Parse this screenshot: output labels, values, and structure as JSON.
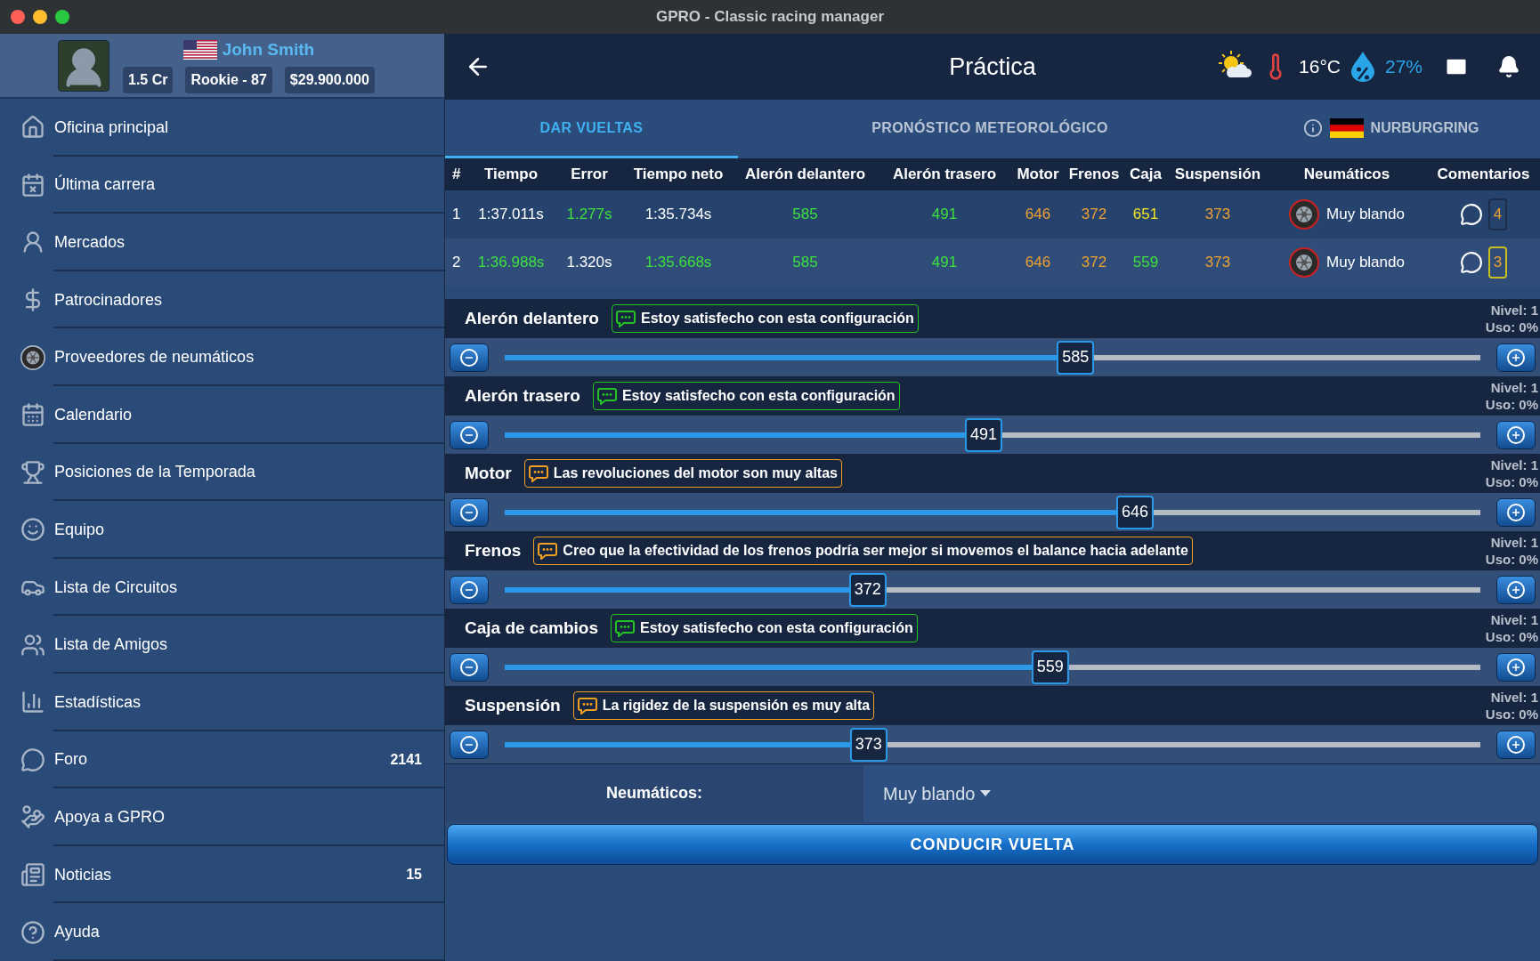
{
  "window": {
    "title": "GPRO - Classic racing manager"
  },
  "profile": {
    "name": "John Smith",
    "badges": [
      "1.5 Cr",
      "Rookie - 87",
      "$29.900.000"
    ]
  },
  "sidebar": {
    "items": [
      {
        "label": "Oficina principal"
      },
      {
        "label": "Última carrera"
      },
      {
        "label": "Mercados"
      },
      {
        "label": "Patrocinadores"
      },
      {
        "label": "Proveedores de neumáticos"
      },
      {
        "label": "Calendario"
      },
      {
        "label": "Posiciones de la Temporada"
      },
      {
        "label": "Equipo"
      },
      {
        "label": "Lista de Circuitos"
      },
      {
        "label": "Lista de Amigos"
      },
      {
        "label": "Estadísticas"
      },
      {
        "label": "Foro",
        "count": "2141"
      },
      {
        "label": "Apoya a GPRO"
      },
      {
        "label": "Noticias",
        "count": "15"
      },
      {
        "label": "Ayuda"
      }
    ]
  },
  "header": {
    "title": "Práctica",
    "temperature": "16°C",
    "humidity": "27%"
  },
  "tabs": [
    {
      "kind": "text",
      "label": "DAR VUELTAS",
      "selected": true
    },
    {
      "kind": "text",
      "label": "PRONÓSTICO METEOROLÓGICO",
      "selected": false
    },
    {
      "kind": "track",
      "label": "NURBURGRING",
      "selected": false
    }
  ],
  "table": {
    "columns": [
      "#",
      "Tiempo",
      "Error",
      "Tiempo neto",
      "Alerón delantero",
      "Alerón trasero",
      "Motor",
      "Frenos",
      "Caja",
      "Suspensión",
      "Neumáticos",
      "Comentarios"
    ],
    "rows": [
      {
        "cells": [
          {
            "text": "1",
            "color": "#ffffff"
          },
          {
            "text": "1:37.011s",
            "color": "#ffffff"
          },
          {
            "text": "1.277s",
            "color": "#3ee03e"
          },
          {
            "text": "1:35.734s",
            "color": "#ffffff"
          },
          {
            "text": "585",
            "color": "#3ee03e"
          },
          {
            "text": "491",
            "color": "#3ee03e"
          },
          {
            "text": "646",
            "color": "#f0a030"
          },
          {
            "text": "372",
            "color": "#f0a030"
          },
          {
            "text": "651",
            "color": "#f2e424"
          },
          {
            "text": "373",
            "color": "#f0a030"
          }
        ],
        "tire": "Muy blando",
        "comments": {
          "count": "4",
          "selected": false
        }
      },
      {
        "cells": [
          {
            "text": "2",
            "color": "#ffffff"
          },
          {
            "text": "1:36.988s",
            "color": "#3ee03e"
          },
          {
            "text": "1.320s",
            "color": "#ffffff"
          },
          {
            "text": "1:35.668s",
            "color": "#3ee03e"
          },
          {
            "text": "585",
            "color": "#3ee03e"
          },
          {
            "text": "491",
            "color": "#3ee03e"
          },
          {
            "text": "646",
            "color": "#f0a030"
          },
          {
            "text": "372",
            "color": "#f0a030"
          },
          {
            "text": "559",
            "color": "#3ee03e"
          },
          {
            "text": "373",
            "color": "#f0a030"
          }
        ],
        "tire": "Muy blando",
        "comments": {
          "count": "3",
          "selected": true
        }
      }
    ]
  },
  "setup": [
    {
      "label": "Alerón delantero",
      "feedback": {
        "text": "Estoy satisfecho con esta configuración",
        "color": "#22c322"
      },
      "level_text": "Nivel: 1",
      "usage_text": "Uso: 0%",
      "value": "585",
      "level": 0.585
    },
    {
      "label": "Alerón trasero",
      "feedback": {
        "text": "Estoy satisfecho con esta configuración",
        "color": "#22c322"
      },
      "level_text": "Nivel: 1",
      "usage_text": "Uso: 0%",
      "value": "491",
      "level": 0.491
    },
    {
      "label": "Motor",
      "feedback": {
        "text": "Las revoluciones del motor son muy altas",
        "color": "#f0a020"
      },
      "level_text": "Nivel: 1",
      "usage_text": "Uso: 0%",
      "value": "646",
      "level": 0.646
    },
    {
      "label": "Frenos",
      "feedback": {
        "text": "Creo que la efectividad de los frenos podría ser mejor si movemos el balance hacia adelante",
        "color": "#f0a020"
      },
      "level_text": "Nivel: 1",
      "usage_text": "Uso: 0%",
      "value": "372",
      "level": 0.372
    },
    {
      "label": "Caja de cambios",
      "feedback": {
        "text": "Estoy satisfecho con esta configuración",
        "color": "#22c322"
      },
      "level_text": "Nivel: 1",
      "usage_text": "Uso: 0%",
      "value": "559",
      "level": 0.559
    },
    {
      "label": "Suspensión",
      "feedback": {
        "text": "La rigidez de la suspensión es muy alta",
        "color": "#f0a020"
      },
      "level_text": "Nivel: 1",
      "usage_text": "Uso: 0%",
      "value": "373",
      "level": 0.373
    }
  ],
  "tires": {
    "label": "Neumáticos:",
    "value": "Muy blando"
  },
  "drive_button": "CONDUCIR VUELTA"
}
